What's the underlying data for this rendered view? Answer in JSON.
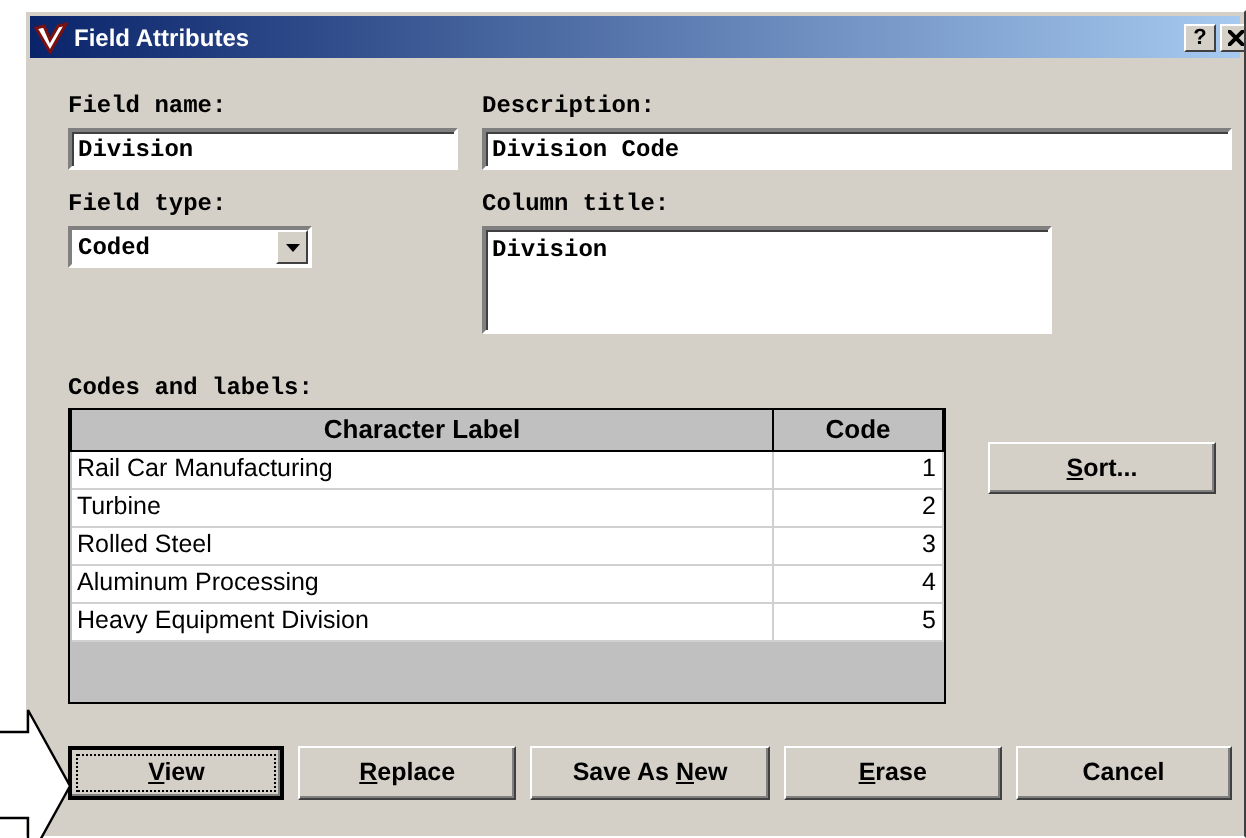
{
  "window": {
    "title": "Field Attributes",
    "help_button": "?"
  },
  "field_name": {
    "label": "Field name:",
    "value": "Division"
  },
  "description": {
    "label": "Description:",
    "value": "Division Code"
  },
  "field_type": {
    "label": "Field type:",
    "value": "Coded"
  },
  "column_title": {
    "label": "Column title:",
    "value": "Division"
  },
  "codes": {
    "label": "Codes and labels:",
    "columns": [
      "Character Label",
      "Code"
    ],
    "rows": [
      [
        "Rail Car Manufacturing",
        "1"
      ],
      [
        "Turbine",
        "2"
      ],
      [
        "Rolled Steel",
        "3"
      ],
      [
        "Aluminum Processing",
        "4"
      ],
      [
        "Heavy Equipment Division",
        "5"
      ]
    ]
  },
  "sort_button": {
    "label": [
      {
        "text": "S",
        "underline": true
      },
      {
        "text": "ort..."
      }
    ]
  },
  "buttons": [
    {
      "label": [
        {
          "text": "V",
          "underline": true
        },
        {
          "text": "iew"
        }
      ],
      "focused": true
    },
    {
      "label": [
        {
          "text": "R",
          "underline": true
        },
        {
          "text": "eplace"
        }
      ],
      "focused": false
    },
    {
      "label": [
        {
          "text": "Save As "
        },
        {
          "text": "N",
          "underline": true
        },
        {
          "text": "ew"
        }
      ],
      "focused": false
    },
    {
      "label": [
        {
          "text": "E",
          "underline": true
        },
        {
          "text": "rase"
        }
      ],
      "focused": false
    },
    {
      "label": [
        {
          "text": "Cancel"
        }
      ],
      "focused": false
    }
  ]
}
